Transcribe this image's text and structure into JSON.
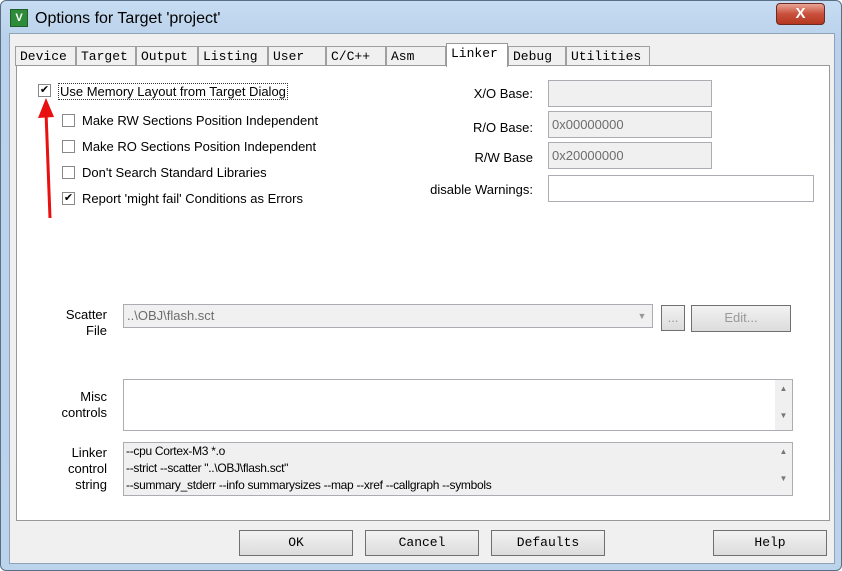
{
  "window": {
    "title": "Options for Target 'project'",
    "close_label": "X",
    "icon_label": "V"
  },
  "tabs": [
    {
      "label": "Device"
    },
    {
      "label": "Target"
    },
    {
      "label": "Output"
    },
    {
      "label": "Listing"
    },
    {
      "label": "User"
    },
    {
      "label": "C/C++"
    },
    {
      "label": "Asm"
    },
    {
      "label": "Linker"
    },
    {
      "label": "Debug"
    },
    {
      "label": "Utilities"
    }
  ],
  "active_tab": "Linker",
  "options": [
    {
      "label": "Use Memory Layout from Target Dialog",
      "checked": true
    },
    {
      "label": "Make RW Sections Position Independent",
      "checked": false
    },
    {
      "label": "Make RO Sections Position Independent",
      "checked": false
    },
    {
      "label": "Don't Search Standard Libraries",
      "checked": false
    },
    {
      "label": "Report 'might fail' Conditions as Errors",
      "checked": true
    }
  ],
  "check_mark": "✔",
  "fields": {
    "xo_base": {
      "label": "X/O Base:",
      "value": ""
    },
    "ro_base": {
      "label": "R/O Base:",
      "value": "0x00000000"
    },
    "rw_base": {
      "label": "R/W Base",
      "value": "0x20000000"
    },
    "disable_warnings": {
      "label": "disable Warnings:",
      "value": ""
    }
  },
  "scatter": {
    "label1": "Scatter",
    "label2": "File",
    "value": "..\\OBJ\\flash.sct",
    "browse_label": "...",
    "edit_label": "Edit..."
  },
  "misc": {
    "label1": "Misc",
    "label2": "controls",
    "value": ""
  },
  "linker_string": {
    "label1": "Linker",
    "label2": "control",
    "label3": "string",
    "lines": [
      "--cpu Cortex-M3 *.o",
      "--strict --scatter \"..\\OBJ\\flash.sct\"",
      "--summary_stderr --info summarysizes --map --xref --callgraph --symbols"
    ]
  },
  "buttons": {
    "ok": "OK",
    "cancel": "Cancel",
    "defaults": "Defaults",
    "help": "Help"
  },
  "annotation_color": "#e81010"
}
